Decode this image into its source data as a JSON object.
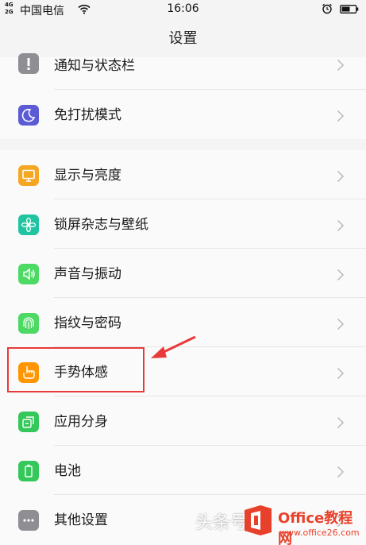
{
  "status_bar": {
    "signal_top": "4G",
    "signal_bottom": "2G",
    "carrier": "中国电信",
    "time": "16:06"
  },
  "header": {
    "title": "设置"
  },
  "settings": {
    "group1": [
      {
        "label": "通知与状态栏",
        "icon": "exclamation-icon",
        "color": "#8e8e93"
      },
      {
        "label": "免打扰模式",
        "icon": "moon-icon",
        "color": "#5b5bd6"
      }
    ],
    "group2": [
      {
        "label": "显示与亮度",
        "icon": "display-icon",
        "color": "#f5a623"
      },
      {
        "label": "锁屏杂志与壁纸",
        "icon": "flower-icon",
        "color": "#20c4a0"
      },
      {
        "label": "声音与振动",
        "icon": "speaker-icon",
        "color": "#4cd964"
      },
      {
        "label": "指纹与密码",
        "icon": "fingerprint-icon",
        "color": "#4cd964"
      },
      {
        "label": "手势体感",
        "icon": "hand-icon",
        "color": "#ff9500"
      },
      {
        "label": "应用分身",
        "icon": "app-clone-icon",
        "color": "#34c759"
      },
      {
        "label": "电池",
        "icon": "battery-icon",
        "color": "#34c759"
      },
      {
        "label": "其他设置",
        "icon": "more-icon",
        "color": "#8e8e93"
      }
    ]
  },
  "annotation": {
    "color": "#e83a3a"
  },
  "watermark": {
    "text": "头条号",
    "brand": "Office教程网",
    "url": "www.office26.com"
  }
}
